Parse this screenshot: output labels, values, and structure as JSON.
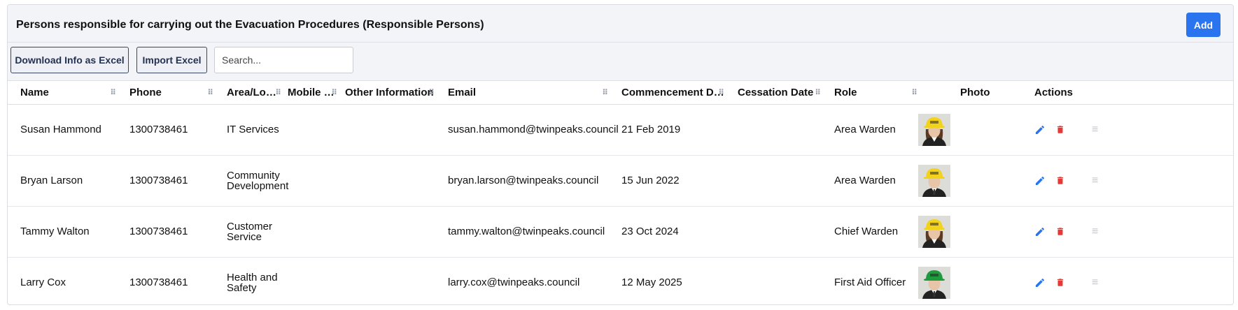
{
  "header": {
    "title": "Persons responsible for carrying out the Evacuation Procedures (Responsible Persons)",
    "add_label": "Add"
  },
  "toolbar": {
    "download_label": "Download Info as Excel",
    "import_label": "Import Excel",
    "search_placeholder": "Search..."
  },
  "columns": [
    "Name",
    "Phone",
    "Area/Location",
    "Mobile Ph...",
    "Other Information",
    "Email",
    "Commencement Date",
    "Cessation Date",
    "Role",
    "Photo",
    "Actions"
  ],
  "rows": [
    {
      "name": "Susan Hammond",
      "phone": "1300738461",
      "area": "IT Services",
      "mobile": "",
      "other": "",
      "email": "susan.hammond@twinpeaks.council",
      "commencement": "21 Feb 2019",
      "cessation": "",
      "role": "Area Warden",
      "helmet": "#f2d21b",
      "gender": "f"
    },
    {
      "name": "Bryan Larson",
      "phone": "1300738461",
      "area": "Community Development",
      "mobile": "",
      "other": "",
      "email": "bryan.larson@twinpeaks.council",
      "commencement": "15 Jun 2022",
      "cessation": "",
      "role": "Area Warden",
      "helmet": "#f2d21b",
      "gender": "m"
    },
    {
      "name": "Tammy Walton",
      "phone": "1300738461",
      "area": "Customer Service",
      "mobile": "",
      "other": "",
      "email": "tammy.walton@twinpeaks.council",
      "commencement": "23 Oct 2024",
      "cessation": "",
      "role": "Chief Warden",
      "helmet": "#f2d21b",
      "gender": "f"
    },
    {
      "name": "Larry Cox",
      "phone": "1300738461",
      "area": "Health and Safety",
      "mobile": "",
      "other": "",
      "email": "larry.cox@twinpeaks.council",
      "commencement": "12 May 2025",
      "cessation": "",
      "role": "First Aid Officer",
      "helmet": "#1f9a3c",
      "gender": "m"
    }
  ],
  "colors": {
    "accent": "#2a74f0",
    "delete": "#e53935",
    "edit": "#2a74f0"
  }
}
